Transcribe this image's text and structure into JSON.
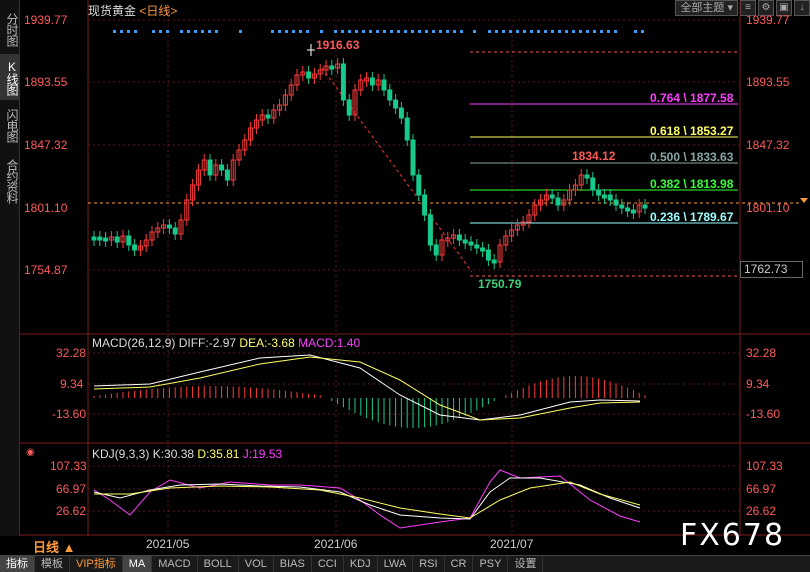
{
  "header": {
    "title": "现货黄金",
    "period": "<日线>",
    "view_dropdown": "全部主题",
    "icons": [
      "menu-icon",
      "settings-icon",
      "restore-icon",
      "arrow-down-icon"
    ]
  },
  "sidebar": {
    "tabs": [
      {
        "label": "分时图",
        "active": false
      },
      {
        "label": "K线图",
        "active": true
      },
      {
        "label": "闪电图",
        "active": false
      },
      {
        "label": "合约资料",
        "active": false
      }
    ]
  },
  "price_axis": {
    "left": [
      "1939.77",
      "1893.55",
      "1847.32",
      "1801.10",
      "1754.87"
    ],
    "right": [
      "1939.77",
      "1893.55",
      "1847.32",
      "1801.10"
    ],
    "current_price": "1762.73"
  },
  "annotations": {
    "high": "1916.63",
    "low": "1750.79",
    "swing_high": "1834.12"
  },
  "fibonacci": [
    {
      "label": "0.764 \\ 1877.58",
      "color": "#ff3dff"
    },
    {
      "label": "0.618 \\ 1853.27",
      "color": "#ffff66"
    },
    {
      "label": "0.500 \\ 1833.63",
      "color": "#8aa6a6"
    },
    {
      "label": "0.382 \\ 1813.98",
      "color": "#33ff33"
    },
    {
      "label": "0.236 \\ 1789.67",
      "color": "#9ff"
    }
  ],
  "macd": {
    "name": "MACD(26,12,9)",
    "diff": "DIFF:-2.97",
    "dea": "DEA:-3.68",
    "macd": "MACD:1.40",
    "axis_left": [
      "32.28",
      "9.34",
      "-13.60"
    ],
    "axis_right": [
      "32.28",
      "9.34",
      "-13.60"
    ]
  },
  "kdj": {
    "name": "KDJ(9,3,3)",
    "k": "K:30.38",
    "d": "D:35.81",
    "j": "J:19.53",
    "axis_left": [
      "107.33",
      "66.97",
      "26.62"
    ],
    "axis_right": [
      "107.33",
      "66.97",
      "26.62"
    ]
  },
  "dates": [
    "2021/05",
    "2021/06",
    "2021/07"
  ],
  "period_button": "日线 ▲",
  "bottom_tabs": [
    {
      "label": "指标",
      "active": true
    },
    {
      "label": "模板",
      "active": false
    },
    {
      "label": "VIP指标",
      "active": false,
      "vip": true
    },
    {
      "label": "MA",
      "active": true
    },
    {
      "label": "MACD",
      "active": false
    },
    {
      "label": "BOLL",
      "active": false
    },
    {
      "label": "VOL",
      "active": false
    },
    {
      "label": "BIAS",
      "active": false
    },
    {
      "label": "CCI",
      "active": false
    },
    {
      "label": "KDJ",
      "active": false
    },
    {
      "label": "LWA",
      "active": false
    },
    {
      "label": "RSI",
      "active": false
    },
    {
      "label": "CR",
      "active": false
    },
    {
      "label": "PSY",
      "active": false
    },
    {
      "label": "设置",
      "active": false
    }
  ],
  "watermark": "FX678"
}
